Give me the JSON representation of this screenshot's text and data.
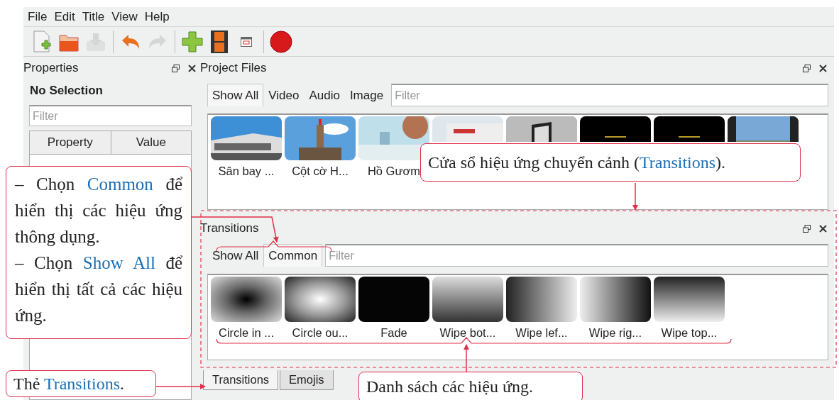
{
  "menu": [
    {
      "label": "File"
    },
    {
      "label": "Edit"
    },
    {
      "label": "Title"
    },
    {
      "label": "View"
    },
    {
      "label": "Help"
    }
  ],
  "toolbar": [
    {
      "kind": "new",
      "disabled": false
    },
    {
      "kind": "open",
      "disabled": false
    },
    {
      "kind": "save",
      "disabled": true
    },
    {
      "kind": "sep"
    },
    {
      "kind": "undo",
      "disabled": false
    },
    {
      "kind": "redo",
      "disabled": true
    },
    {
      "kind": "sep"
    },
    {
      "kind": "add",
      "disabled": false
    },
    {
      "kind": "film",
      "disabled": false
    },
    {
      "kind": "window",
      "disabled": false
    },
    {
      "kind": "sep"
    },
    {
      "kind": "record",
      "disabled": false
    }
  ],
  "properties": {
    "title": "Properties",
    "selection": "No Selection",
    "filter": {
      "placeholder": "Filter"
    },
    "columns": [
      "Property",
      "Value"
    ]
  },
  "project_files": {
    "title": "Project Files",
    "tabs": [
      {
        "label": "Show All",
        "selected": true
      },
      {
        "label": "Video",
        "selected": false
      },
      {
        "label": "Audio",
        "selected": false
      },
      {
        "label": "Image",
        "selected": false
      }
    ],
    "filter": {
      "placeholder": "Filter"
    },
    "items": [
      {
        "kind": "picture",
        "label": "Sân bay ..."
      },
      {
        "kind": "picture",
        "label": "Cột cờ H..."
      },
      {
        "kind": "picture",
        "label": "Hồ Gươm"
      },
      {
        "kind": "picture"
      },
      {
        "kind": "picture"
      },
      {
        "kind": "picture"
      },
      {
        "kind": "picture"
      },
      {
        "kind": "picture"
      }
    ]
  },
  "transitions": {
    "title": "Transitions",
    "tabs": [
      {
        "label": "Show All",
        "selected": false
      },
      {
        "label": "Common",
        "selected": true
      }
    ],
    "filter": {
      "placeholder": "Filter"
    },
    "items": [
      {
        "kind": "circle_in",
        "label": "Circle in ..."
      },
      {
        "kind": "circle_out",
        "label": "Circle ou..."
      },
      {
        "kind": "fade",
        "label": "Fade"
      },
      {
        "kind": "wipe_bottom",
        "label": "Wipe bot..."
      },
      {
        "kind": "wipe_left",
        "label": "Wipe lef..."
      },
      {
        "kind": "wipe_right",
        "label": "Wipe rig..."
      },
      {
        "kind": "wipe_top",
        "label": "Wipe top..."
      }
    ]
  },
  "bottom_tabs": [
    {
      "label": "Transitions",
      "selected": true
    },
    {
      "label": "Emojis",
      "selected": false
    }
  ],
  "callouts": [
    {
      "kind": "window",
      "paragraphs": [
        [
          {
            "text": "Cửa sổ hiệu ứng chuyển cảnh (",
            "highlight": false
          },
          {
            "text": "Transitions",
            "highlight": true
          },
          {
            "text": ").",
            "highlight": false
          }
        ]
      ]
    },
    {
      "kind": "filters",
      "paragraphs": [
        [
          {
            "text": "– Chọn ",
            "highlight": false
          },
          {
            "text": "Common",
            "highlight": true
          },
          {
            "text": " để hiển thị các hiệu ứng thông dụng.",
            "highlight": false
          }
        ],
        [
          {
            "text": "– Chọn ",
            "highlight": false
          },
          {
            "text": "Show All",
            "highlight": true
          },
          {
            "text": " để hiển thị tất cả các hiệu ứng.",
            "highlight": false
          }
        ]
      ]
    },
    {
      "kind": "tab",
      "paragraphs": [
        [
          {
            "text": "Thẻ ",
            "highlight": false
          },
          {
            "text": "Transitions",
            "highlight": true
          },
          {
            "text": ".",
            "highlight": false
          }
        ]
      ]
    },
    {
      "kind": "list",
      "paragraphs": [
        [
          {
            "text": "Danh sách các hiệu ứng.",
            "highlight": false
          }
        ]
      ]
    }
  ]
}
